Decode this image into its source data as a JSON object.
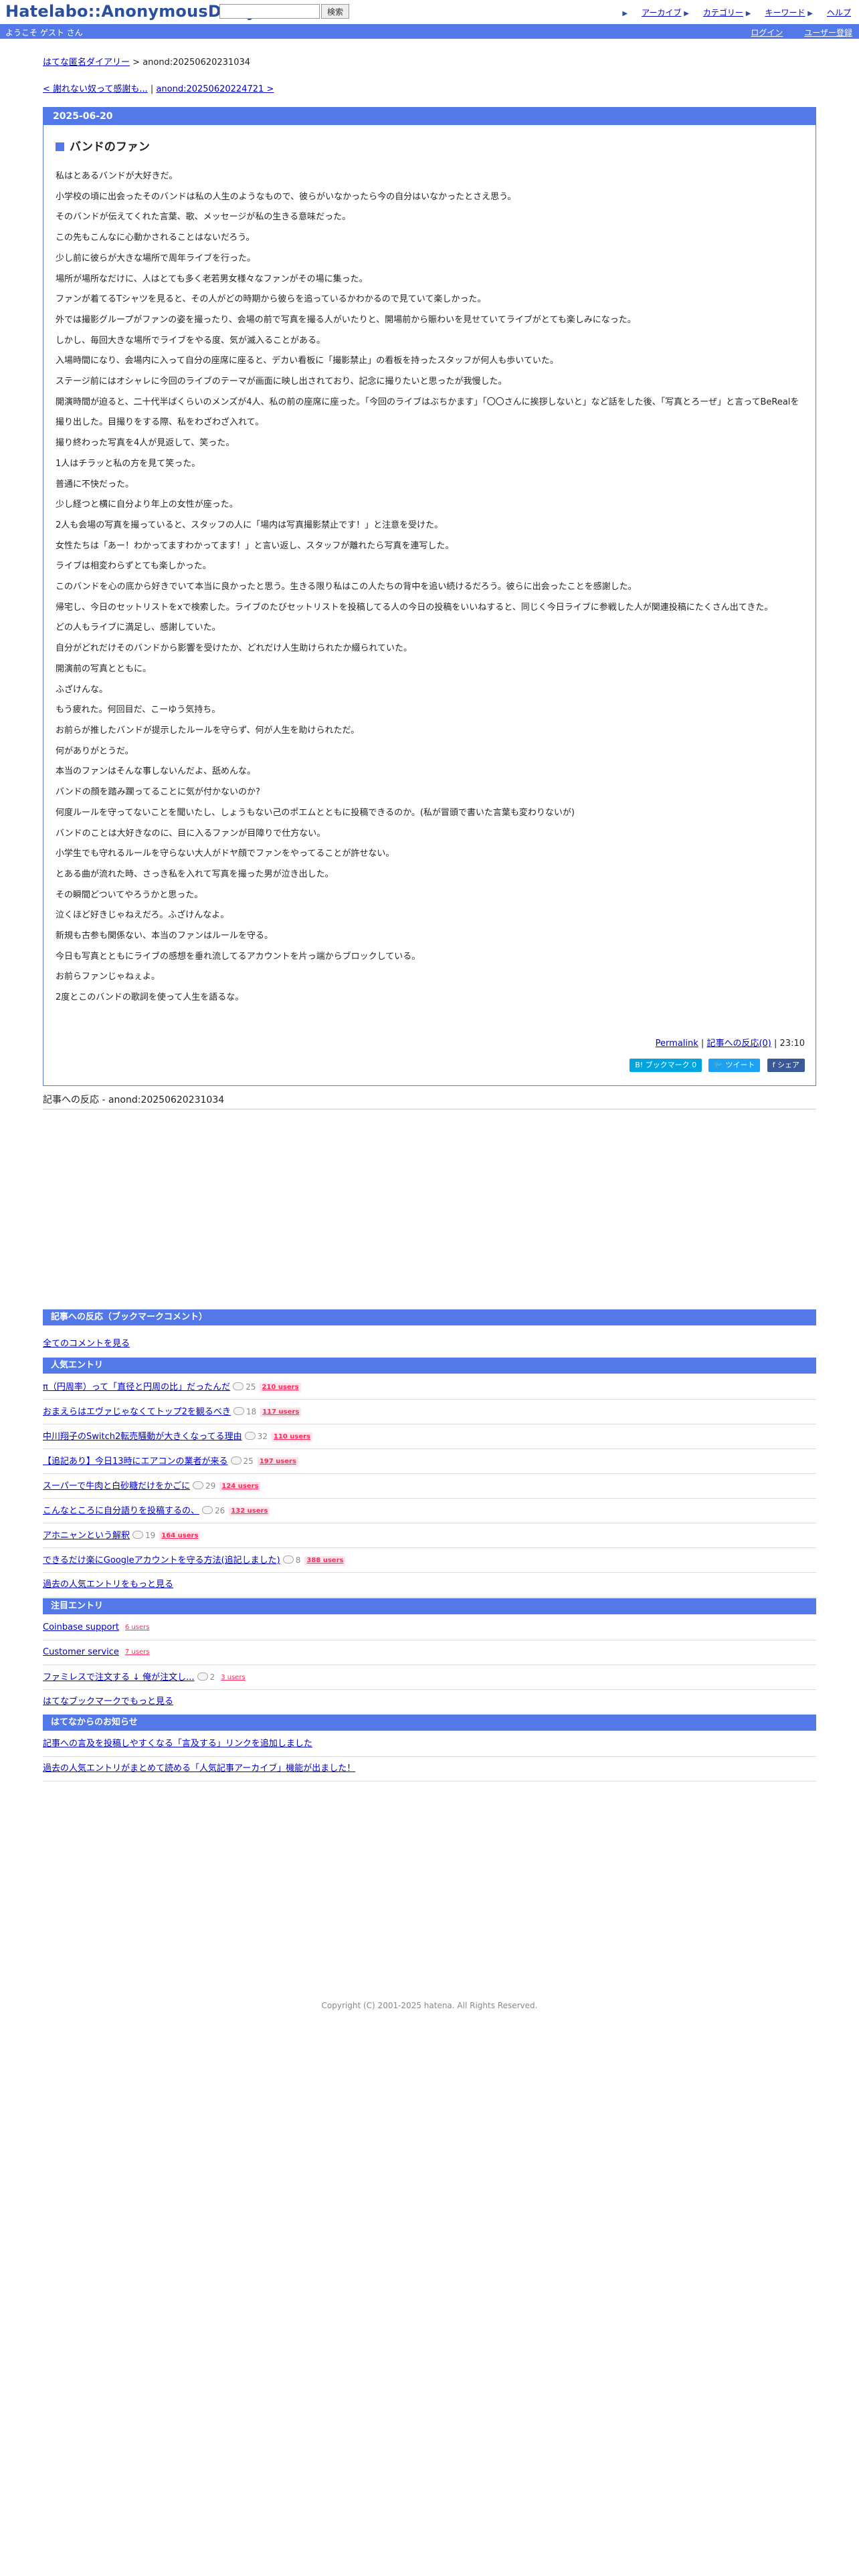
{
  "header": {
    "logo": "Hatelabo::AnonymousDiary",
    "search_placeholder": "",
    "search_button": "検索",
    "links": [
      "アーカイブ",
      "カテゴリー",
      "キーワード",
      "ヘルプ"
    ]
  },
  "userbar": {
    "welcome": "ようこそ ゲスト さん",
    "login": "ログイン",
    "register": "ユーザー登録"
  },
  "breadcrumb": {
    "home": "はてな匿名ダイアリー",
    "sep": " > ",
    "current": "anond:20250620231034"
  },
  "pager": {
    "prev": "< 謝れない奴って感謝も...",
    "sep": " | ",
    "next": "anond:20250620224721 >"
  },
  "entry": {
    "date": "2025-06-20",
    "title": "バンドのファン",
    "paragraphs": [
      "私はとあるバンドが大好きだ。",
      "小学校の頃に出会ったそのバンドは私の人生のようなもので、彼らがいなかったら今の自分はいなかったとさえ思う。",
      "そのバンドが伝えてくれた言葉、歌、メッセージが私の生きる意味だった。",
      "この先もこんなに心動かされることはないだろう。",
      "少し前に彼らが大きな場所で周年ライブを行った。",
      "場所が場所なだけに、人はとても多く老若男女様々なファンがその場に集った。",
      "ファンが着てるTシャツを見ると、その人がどの時期から彼らを追っているかわかるので見ていて楽しかった。",
      "外では撮影グループがファンの姿を撮ったり、会場の前で写真を撮る人がいたりと、開場前から賑わいを見せていてライブがとても楽しみになった。",
      "しかし、毎回大きな場所でライブをやる度、気が滅入ることがある。",
      "入場時間になり、会場内に入って自分の座席に座ると、デカい看板に「撮影禁止」の看板を持ったスタッフが何人も歩いていた。",
      "ステージ前にはオシャレに今回のライブのテーマが画面に映し出されており、記念に撮りたいと思ったが我慢した。",
      "開演時間が迫ると、二十代半ばくらいのメンズが4人、私の前の座席に座った。「今回のライブはぶちかます」「〇〇さんに挨拶しないと」など話をした後、「写真とろーぜ」と言ってBeRealを撮り出した。目撮りをする際、私をわざわざ入れて。",
      "撮り終わった写真を4人が見返して、笑った。",
      "1人はチラッと私の方を見て笑った。",
      "普通に不快だった。",
      "少し経つと横に自分より年上の女性が座った。",
      "2人も会場の写真を撮っていると、スタッフの人に「場内は写真撮影禁止です！」と注意を受けた。",
      "女性たちは「あー！わかってますわかってます！」と言い返し、スタッフが離れたら写真を連写した。",
      "ライブは相変わらずとても楽しかった。",
      "このバンドを心の底から好きでいて本当に良かったと思う。生きる限り私はこの人たちの背中を追い続けるだろう。彼らに出会ったことを感謝した。",
      "帰宅し、今日のセットリストをxで検索した。ライブのたびセットリストを投稿してる人の今日の投稿をいいねすると、同じく今日ライブに参戦した人が関連投稿にたくさん出てきた。",
      "どの人もライブに満足し、感謝していた。",
      "自分がどれだけそのバンドから影響を受けたか、どれだけ人生助けられたか綴られていた。",
      "開演前の写真とともに。",
      "ふざけんな。",
      "もう疲れた。何回目だ、こーゆう気持ち。",
      "お前らが推したバンドが提示したルールを守らず、何が人生を助けられただ。",
      "何がありがとうだ。",
      "本当のファンはそんな事しないんだよ、舐めんな。",
      "バンドの顔を踏み躙ってることに気が付かないのか?",
      "何度ルールを守ってないことを聞いたし、しょうもない己のポエムとともに投稿できるのか。(私が冒頭で書いた言葉も変わりないが)",
      "バンドのことは大好きなのに、目に入るファンが目障りで仕方ない。",
      "小学生でも守れるルールを守らない大人がドヤ顔でファンをやってることが許せない。",
      "とある曲が流れた時、さっき私を入れて写真を撮った男が泣き出した。",
      "その瞬間どついてやろうかと思った。",
      "泣くほど好きじゃねえだろ。ふざけんなよ。",
      "新規も古参も関係ない、本当のファンはルールを守る。",
      "今日も写真とともにライブの感想を垂れ流してるアカウントを片っ端からブロックしている。",
      "お前らファンじゃねぇよ。",
      "2度とこのバンドの歌詞を使って人生を語るな。"
    ],
    "permalink": "Permalink",
    "reactions_link": "記事への反応(0)",
    "time": "23:10",
    "share": {
      "hatebu": "B! ブックマーク",
      "hatebu_count": "0",
      "tweet": "ツイート",
      "facebook": "シェア"
    }
  },
  "reaction_heading": "記事への反応 - anond:20250620231034",
  "bookmark_section": {
    "heading": "記事への反応（ブックマークコメント）",
    "all_comments": "全てのコメントを見る"
  },
  "popular": {
    "heading": "人気エントリ",
    "items": [
      {
        "title": "π（円周率）って「直径と円周の比」だったんだ",
        "comments": "25",
        "users": "210 users"
      },
      {
        "title": "おまえらはエヴァじゃなくてトップ2を観るべき",
        "comments": "18",
        "users": "117 users"
      },
      {
        "title": "中川翔子のSwitch2転売騒動が大きくなってる理由",
        "comments": "32",
        "users": "110 users"
      },
      {
        "title": "【追記あり】今日13時にエアコンの業者が来る",
        "comments": "25",
        "users": "197 users"
      },
      {
        "title": "スーパーで牛肉と白砂糖だけをかごに",
        "comments": "29",
        "users": "124 users"
      },
      {
        "title": "こんなところに自分語りを投稿するの、",
        "comments": "26",
        "users": "132 users"
      },
      {
        "title": "アホニャンという解釈",
        "comments": "19",
        "users": "164 users"
      },
      {
        "title": "できるだけ楽にGoogleアカウントを守る方法(追記しました)",
        "comments": "8",
        "users": "388 users"
      }
    ],
    "more": "過去の人気エントリをもっと見る"
  },
  "attention": {
    "heading": "注目エントリ",
    "items": [
      {
        "title": "Coinbase support",
        "comments": "",
        "users": "6 users"
      },
      {
        "title": "Customer service",
        "comments": "",
        "users": "7 users"
      },
      {
        "title": "ファミレスで注文する ↓ 俺が注文し...",
        "comments": "2",
        "users": "3 users"
      }
    ],
    "more": "はてなブックマークでもっと見る"
  },
  "news": {
    "heading": "はてなからのお知らせ",
    "items": [
      "記事への言及を投稿しやすくなる「言及する」リンクを追加しました",
      "過去の人気エントリがまとめて読める「人気記事アーカイブ」機能が出ました！"
    ]
  },
  "footer": {
    "copyright": "Copyright (C) 2001-2025 hatena. All Rights Reserved."
  }
}
